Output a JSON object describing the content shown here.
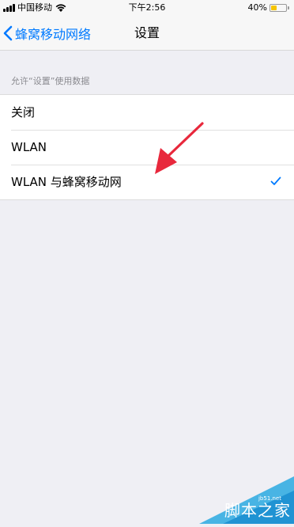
{
  "status_bar": {
    "carrier": "中国移动",
    "time": "下午2:56",
    "battery": "40%",
    "battery_level": 0.4
  },
  "nav": {
    "back_label": "蜂窝移动网络",
    "title": "设置"
  },
  "section": {
    "header": "允许“设置”使用数据"
  },
  "options": [
    {
      "label": "关闭",
      "selected": false
    },
    {
      "label": "WLAN",
      "selected": false
    },
    {
      "label": "WLAN 与蜂窝移动网",
      "selected": true
    }
  ],
  "colors": {
    "accent": "#007aff",
    "annotation_arrow": "#e8283c",
    "background": "#efeff4"
  },
  "watermark": {
    "text": "脚本之家",
    "url": "jb51.net"
  }
}
